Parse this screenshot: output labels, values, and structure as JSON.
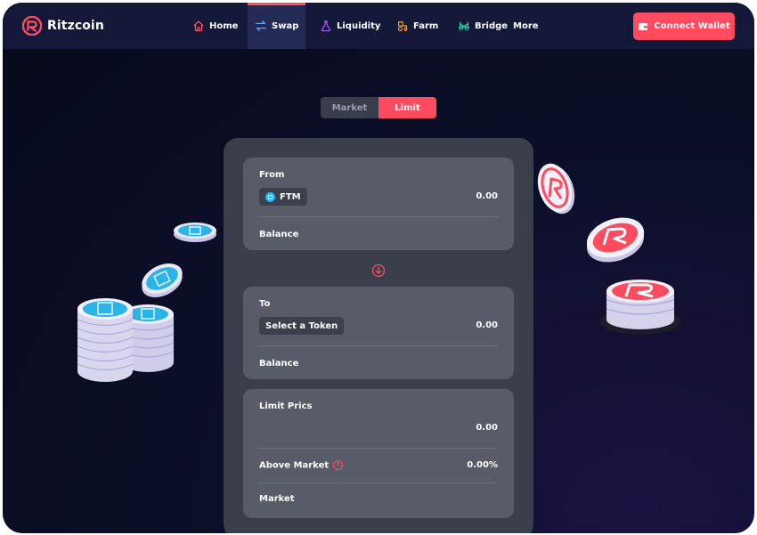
{
  "brand": {
    "name": "Ritzcoin",
    "accent": "#ff4b60"
  },
  "nav": {
    "items": [
      {
        "label": "Home",
        "icon": "home-icon"
      },
      {
        "label": "Swap",
        "icon": "swap-icon",
        "active": true
      },
      {
        "label": "Liquidity",
        "icon": "flask-icon"
      },
      {
        "label": "Farm",
        "icon": "tractor-icon"
      },
      {
        "label": "Bridge",
        "icon": "bridge-icon"
      }
    ],
    "more": "More",
    "connect": "Connect Wallet"
  },
  "mode": {
    "market": "Market",
    "limit": "Limit",
    "selected": "Limit"
  },
  "from": {
    "label": "From",
    "token": "FTM",
    "amount": "0.00",
    "balance_label": "Balance"
  },
  "to": {
    "label": "To",
    "token": "Select a Token",
    "amount": "0.00",
    "balance_label": "Balance"
  },
  "limit": {
    "label": "Limit Prics",
    "amount": "0.00",
    "above_label": "Above Market",
    "above_value": "0.00%",
    "market_label": "Market"
  }
}
